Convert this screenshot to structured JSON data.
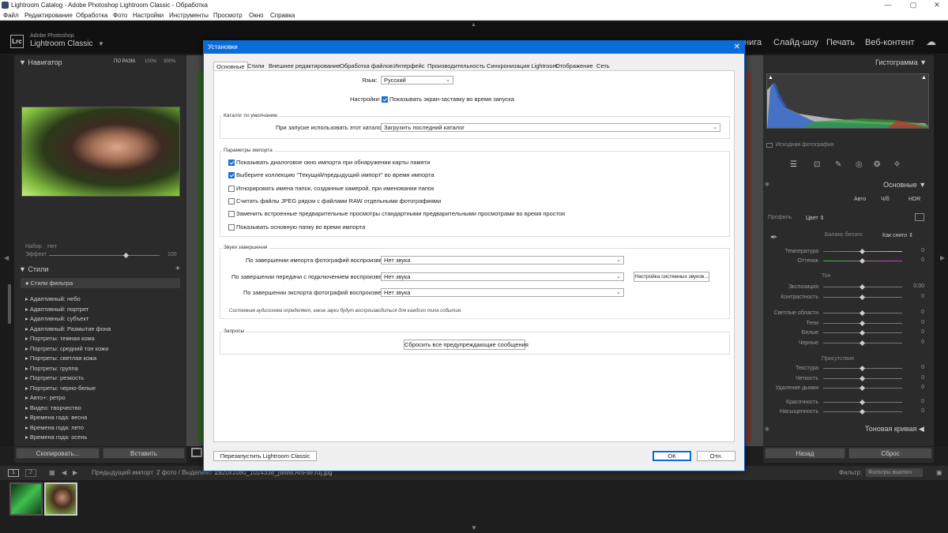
{
  "window": {
    "title": "Lightroom Catalog - Adobe Photoshop Lightroom Classic - Обработка",
    "controls": [
      "—",
      "▢",
      "✕"
    ]
  },
  "menu": [
    "Файл",
    "Редактирование",
    "Обработка",
    "Фото",
    "Настройки",
    "Инструменты",
    "Просмотр",
    "Окно",
    "Справка"
  ],
  "brand": {
    "logo": "Lrc",
    "line1": "Adobe Photoshop",
    "line2": "Lightroom Classic"
  },
  "modules": [
    "нига",
    "Слайд-шоу",
    "Печать",
    "Веб-контент"
  ],
  "left": {
    "navigator": "Навигатор",
    "nav_zoom": [
      "ПО РАЗМ.",
      "100%",
      "300%"
    ],
    "preset_label": "Набор",
    "preset_value": "Нет",
    "effect_label": "Эффект",
    "effect_value": "100",
    "styles_title": "Стили",
    "styles_filter": "Стили фильтра",
    "styles": [
      "Адаптивный: небо",
      "Адаптивный: портрет",
      "Адаптивный: субъект",
      "Адаптивный: Размытие фона",
      "Портреты: темная кожа",
      "Портреты: средний тон кожи",
      "Портреты: светлая кожа",
      "Портреты: группа",
      "Портреты: резкость",
      "Портреты: черно-белые",
      "Авто+: ретро",
      "Видео: творчество",
      "Времена года: весна",
      "Времена года: лето",
      "Времена года: осень"
    ],
    "copy": "Скопировать...",
    "paste": "Вставить"
  },
  "right": {
    "histogram": "Гистограмма",
    "original": "Исходная фотография",
    "basic": "Основные",
    "auto": "Авто",
    "bw": "Ч/б",
    "hdr": "HDR",
    "profile_label": "Профиль",
    "profile_value": "Цвет",
    "wb_label": "Баланс белого",
    "wb_value": "Как снято",
    "sliders": [
      {
        "label": "Температура",
        "value": "0"
      },
      {
        "label": "Оттенок",
        "value": "0"
      },
      {
        "label": "Экспозиция",
        "value": "0,00"
      },
      {
        "label": "Контрастность",
        "value": "0"
      },
      {
        "label": "Светлые области",
        "value": "0"
      },
      {
        "label": "Тени",
        "value": "0"
      },
      {
        "label": "Белые",
        "value": "0"
      },
      {
        "label": "Черные",
        "value": "0"
      },
      {
        "label": "Текстура",
        "value": "0"
      },
      {
        "label": "Четкость",
        "value": "0"
      },
      {
        "label": "Удаление дымки",
        "value": "0"
      },
      {
        "label": "Красочность",
        "value": "0"
      },
      {
        "label": "Насыщенность",
        "value": "0"
      }
    ],
    "tone": "Тон",
    "presence": "Присутствие",
    "tone_curve": "Тоновая кривая",
    "back": "Назад",
    "reset": "Сброс"
  },
  "filmbar": {
    "source": "Предыдущий импорт",
    "count": "2 фото / Выделено 1 /",
    "file": "1920x1080_1024338_[www.ArtFile.ru].jpg",
    "filter_label": "Фильтр:",
    "filter_value": "Фильтры выключ"
  },
  "dialog": {
    "title": "Установки",
    "close": "✕",
    "tabs": [
      "Основные",
      "Стили",
      "Внешнее редактирование",
      "Обработка файлов",
      "Интерфейс",
      "Производительность",
      "Синхронизация Lightroom",
      "Отображение",
      "Сеть"
    ],
    "lang_label": "Язык:",
    "lang_value": "Русский",
    "settings_label": "Настройки:",
    "splash": "Показывать экран-заставку во время запуска",
    "catalog_group": "Каталог по умолчанию",
    "catalog_label": "При запуске использовать этот каталог:",
    "catalog_value": "Загрузить последний каталог",
    "import_group": "Параметры импорта",
    "import_opts": [
      {
        "text": "Показывать диалоговое окно импорта при обнаружении карты памяти",
        "checked": true
      },
      {
        "text": "Выберите коллекцию \"Текущий/предыдущий импорт\" во время импорта",
        "checked": true
      },
      {
        "text": "Игнорировать имена папок, созданные камерой, при именовании папок",
        "checked": false
      },
      {
        "text": "Считать файлы JPEG рядом с файлами RAW отдельными фотографиями",
        "checked": false
      },
      {
        "text": "Заменить встроенные предварительные просмотры стандартными предварительными просмотрами во время простоя",
        "checked": false
      },
      {
        "text": "Показывать основную папку во время импорта",
        "checked": false
      }
    ],
    "sounds_group": "Звуки завершения",
    "sound1_label": "По завершении импорта фотографий воспроизвести:",
    "sound1_value": "Нет звука",
    "sound2_label": "По завершении передачи с подключением воспроизвести:",
    "sound2_value": "Нет звука",
    "sound3_label": "По завершении экспорта фотографий воспроизвести:",
    "sound3_value": "Нет звука",
    "sys_sounds": "Настройка системных звуков...",
    "sound_note": "Системная аудиосхема определяет, какие звуки будут воспроизводиться для каждого типа события.",
    "prompts_group": "Запросы",
    "reset_warnings": "Сбросить все предупреждающие сообщения",
    "restart": "Перезапустить Lightroom Classic",
    "ok": "ОК",
    "cancel": "Отн."
  }
}
